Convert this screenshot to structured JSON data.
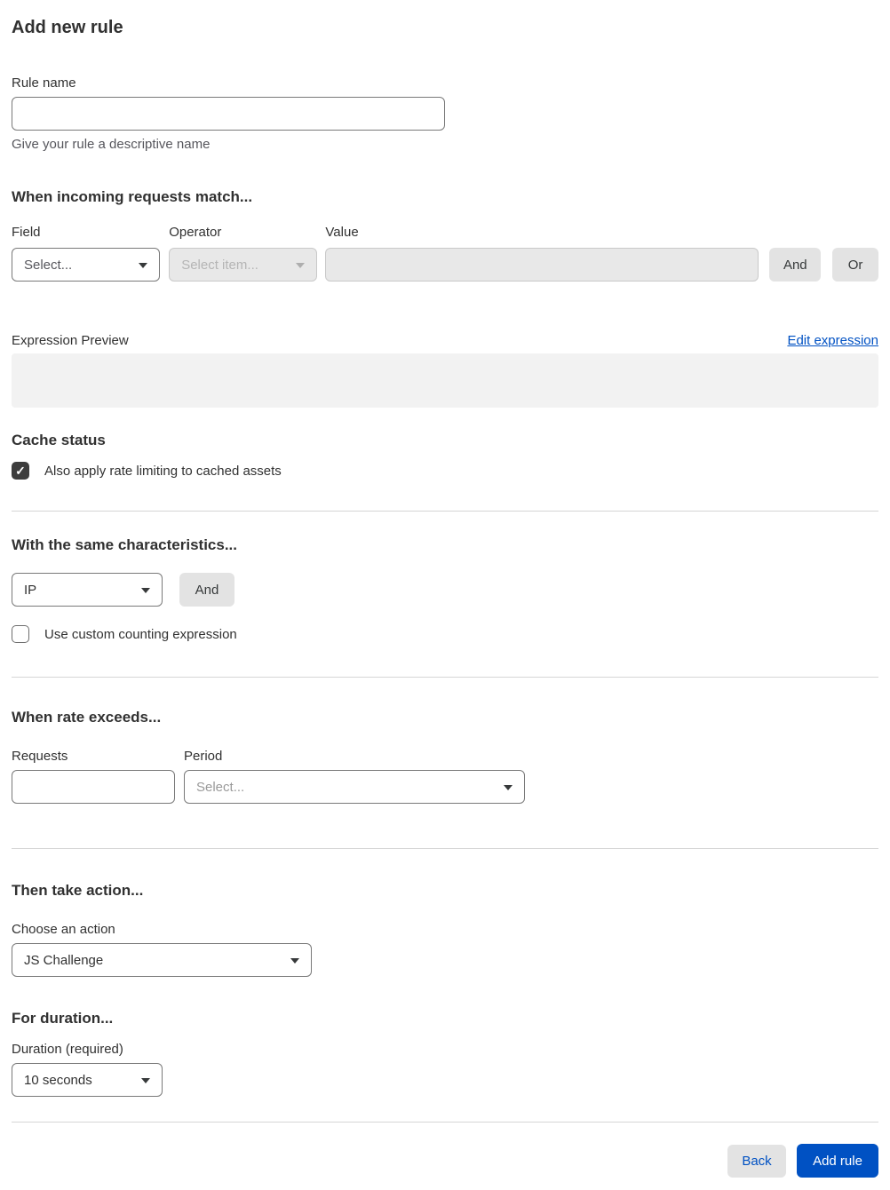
{
  "page": {
    "title": "Add new rule"
  },
  "rule_name": {
    "label": "Rule name",
    "value": "",
    "helper": "Give your rule a descriptive name"
  },
  "match": {
    "heading": "When incoming requests match...",
    "field_label": "Field",
    "field_value": "Select...",
    "operator_label": "Operator",
    "operator_value": "Select item...",
    "value_label": "Value",
    "value_text": "",
    "and_label": "And",
    "or_label": "Or"
  },
  "expression": {
    "preview_label": "Expression Preview",
    "edit_link": "Edit expression",
    "preview_value": ""
  },
  "cache": {
    "heading": "Cache status",
    "checkbox_label": "Also apply rate limiting to cached assets",
    "checked": true
  },
  "characteristics": {
    "heading": "With the same characteristics...",
    "select_value": "IP",
    "and_label": "And",
    "checkbox_label": "Use custom counting expression",
    "checked": false
  },
  "rate": {
    "heading": "When rate exceeds...",
    "requests_label": "Requests",
    "requests_value": "",
    "period_label": "Period",
    "period_value": "Select..."
  },
  "action": {
    "heading": "Then take action...",
    "label": "Choose an action",
    "value": "JS Challenge"
  },
  "duration": {
    "heading": "For duration...",
    "label": "Duration (required)",
    "value": "10 seconds"
  },
  "footer": {
    "back_label": "Back",
    "submit_label": "Add rule"
  },
  "icons": {
    "checkmark": "✓",
    "chevron_down": "▾"
  },
  "colors": {
    "accent_blue": "#0051c3",
    "text": "#313131",
    "border": "#797979",
    "disabled_bg": "#e8e8e8",
    "button_gray": "#e3e3e3",
    "divider": "#d5d5d5",
    "preview_bg": "#f2f2f2",
    "checkbox_checked": "#3d3d3d"
  }
}
